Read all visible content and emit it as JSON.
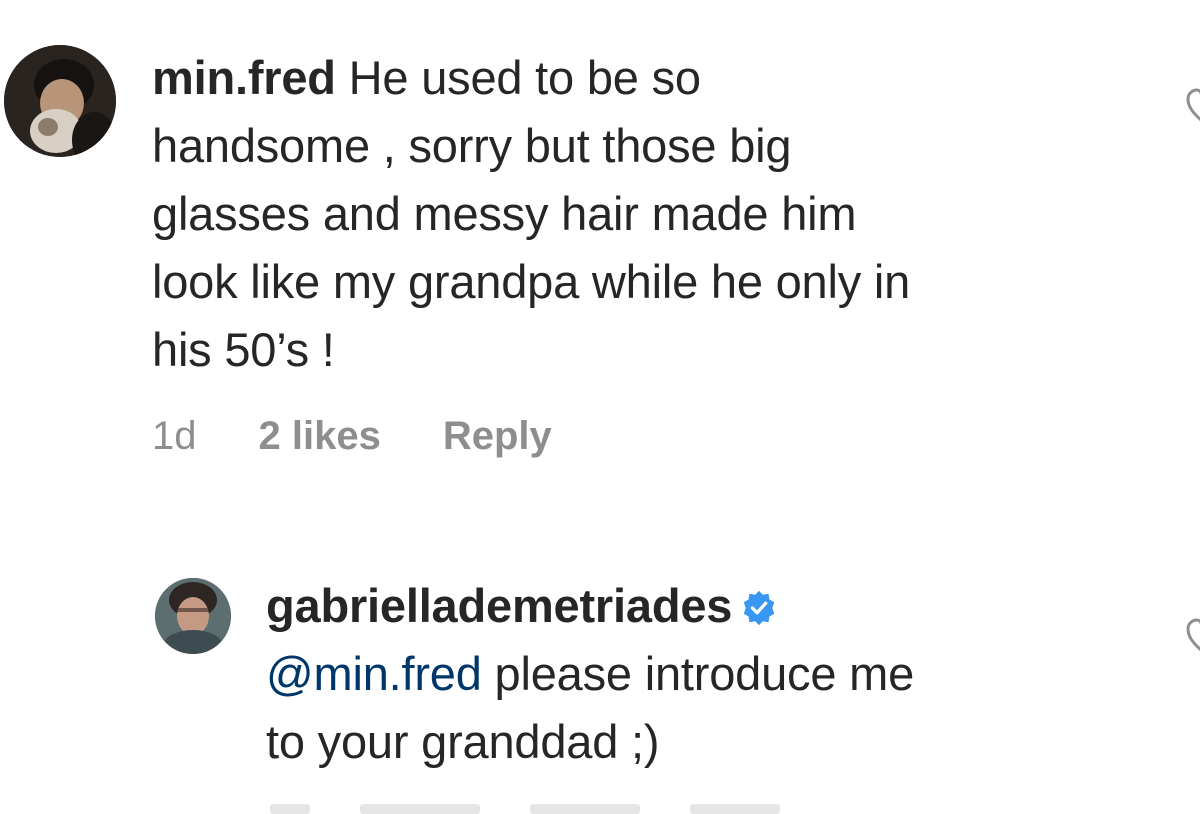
{
  "comments": [
    {
      "username": "min.fred",
      "lines": [
        "He used to be so",
        "handsome , sorry but those big",
        "glasses and messy hair made him",
        "look like my grandpa while he only in",
        "his 50’s !"
      ],
      "time": "1d",
      "likes": "2 likes",
      "reply_label": "Reply",
      "avatar_icon": "user-avatar-icon",
      "like_icon": "heart-outline-icon"
    },
    {
      "username": "gabriellademetriades",
      "verified": true,
      "mention": "@min.fred",
      "line1_rest": " please introduce me",
      "line2": "to your granddad ;)",
      "avatar_icon": "user-avatar-icon",
      "verified_icon": "verified-badge-icon",
      "like_icon": "heart-outline-icon"
    }
  ],
  "colors": {
    "text": "#262626",
    "secondary": "#8e8e8e",
    "mention": "#00376b",
    "verified": "#3897f0"
  }
}
